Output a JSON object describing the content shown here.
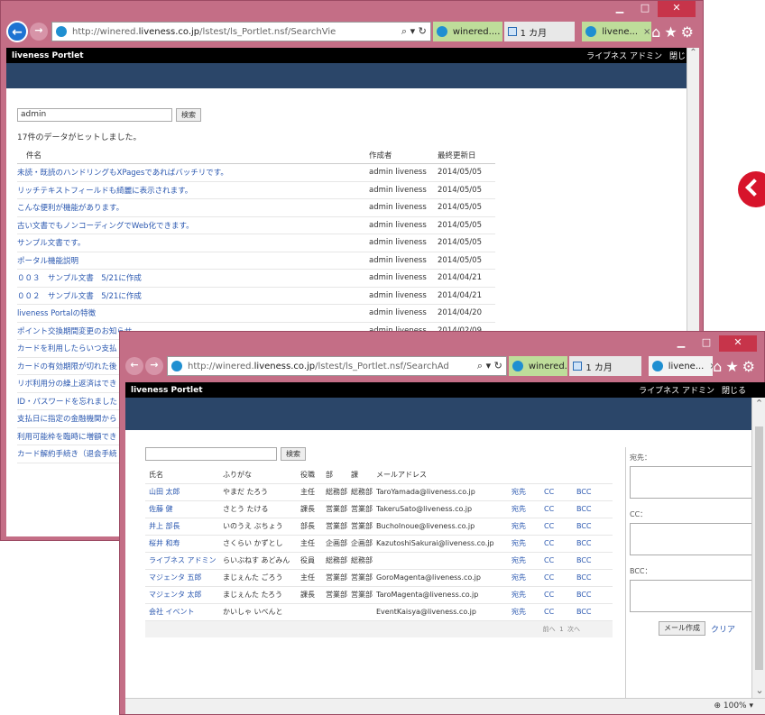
{
  "window1": {
    "address_url_prefix": "http://winered.",
    "address_url_domain": "liveness.co.jp",
    "address_url_suffix": "/lstest/ls_Portlet.nsf/SearchVie",
    "tabs": [
      {
        "label": "winered...."
      },
      {
        "label": "1 カ月"
      },
      {
        "label": "livene...",
        "close": "×"
      }
    ],
    "portal_title": "liveness Portlet",
    "user_name": "ライブネス アドミン",
    "close_link": "閉じる",
    "search_value": "admin",
    "search_button": "検索",
    "result_text": "17件のデータがヒットしました。",
    "columns": {
      "subject": "件名",
      "author": "作成者",
      "updated": "最終更新日"
    },
    "rows": [
      {
        "subject": "未読・既読のハンドリングもXPagesであればバッチリです。",
        "author": "admin liveness",
        "date": "2014/05/05"
      },
      {
        "subject": "リッチテキストフィールドも綺麗に表示されます。",
        "author": "admin liveness",
        "date": "2014/05/05"
      },
      {
        "subject": "こんな便利が機能があります。",
        "author": "admin liveness",
        "date": "2014/05/05"
      },
      {
        "subject": "古い文書でもノンコーディングでWeb化できます。",
        "author": "admin liveness",
        "date": "2014/05/05"
      },
      {
        "subject": "サンプル文書です。",
        "author": "admin liveness",
        "date": "2014/05/05"
      },
      {
        "subject": "ポータル機能説明",
        "author": "admin liveness",
        "date": "2014/05/05"
      },
      {
        "subject": "００３　サンプル文書　5/21に作成",
        "author": "admin liveness",
        "date": "2014/04/21"
      },
      {
        "subject": "００２　サンプル文書　5/21に作成",
        "author": "admin liveness",
        "date": "2014/04/21"
      },
      {
        "subject": "liveness Portalの特徴",
        "author": "admin liveness",
        "date": "2014/04/20"
      },
      {
        "subject": "ポイント交換期間変更のお知らせ",
        "author": "admin liveness",
        "date": "2014/02/09"
      },
      {
        "subject": "カードを利用したらいつ支払",
        "author": "",
        "date": ""
      },
      {
        "subject": "カードの有効期限が切れた後",
        "author": "",
        "date": ""
      },
      {
        "subject": "リボ利用分の繰上返済はでき",
        "author": "",
        "date": ""
      },
      {
        "subject": "ID・パスワードを忘れました",
        "author": "",
        "date": ""
      },
      {
        "subject": "支払日に指定の金融機関から",
        "author": "",
        "date": ""
      },
      {
        "subject": "利用可能枠を臨時に増額でき",
        "author": "",
        "date": ""
      },
      {
        "subject": "カード解約手続き（退会手続",
        "author": "",
        "date": ""
      }
    ]
  },
  "window2": {
    "address_url_prefix": "http://winered.",
    "address_url_domain": "liveness.co.jp",
    "address_url_suffix": "/lstest/ls_Portlet.nsf/SearchAd",
    "tabs": [
      {
        "label": "winered...."
      },
      {
        "label": "1 カ月"
      },
      {
        "label": "livene...",
        "close": "×"
      }
    ],
    "portal_title": "liveness Portlet",
    "user_name": "ライブネス アドミン",
    "close_link": "閉じる",
    "search_value": "",
    "search_button": "検索",
    "columns": {
      "name": "氏名",
      "kana": "ふりがな",
      "title": "役職",
      "dept": "部",
      "section": "課",
      "email": "メールアドレス"
    },
    "rows": [
      {
        "name": "山田 太郎",
        "kana": "やまだ たろう",
        "title": "主任",
        "dept": "総務部",
        "section": "総務部",
        "email": "TaroYamada@liveness.co.jp"
      },
      {
        "name": "佐藤 健",
        "kana": "さとう たける",
        "title": "課長",
        "dept": "営業部",
        "section": "営業部",
        "email": "TakeruSato@liveness.co.jp"
      },
      {
        "name": "井上 部長",
        "kana": "いのうえ ぶちょう",
        "title": "部長",
        "dept": "営業部",
        "section": "営業部",
        "email": "BuchoInoue@liveness.co.jp"
      },
      {
        "name": "桜井 和寿",
        "kana": "さくらい かずとし",
        "title": "主任",
        "dept": "企画部",
        "section": "企画部",
        "email": "KazutoshiSakurai@liveness.co.jp"
      },
      {
        "name": "ライブネス アドミン",
        "kana": "らいぶねす あどみん",
        "title": "役員",
        "dept": "総務部",
        "section": "総務部",
        "email": ""
      },
      {
        "name": "マジェンタ 五郎",
        "kana": "まじぇんた ごろう",
        "title": "主任",
        "dept": "営業部",
        "section": "営業部",
        "email": "GoroMagenta@liveness.co.jp"
      },
      {
        "name": "マジェンタ 太郎",
        "kana": "まじぇんた たろう",
        "title": "課長",
        "dept": "営業部",
        "section": "営業部",
        "email": "TaroMagenta@liveness.co.jp"
      },
      {
        "name": "会社 イベント",
        "kana": "かいしゃ いべんと",
        "title": "",
        "dept": "",
        "section": "",
        "email": "EventKaisya@liveness.co.jp"
      }
    ],
    "action_to": "宛先",
    "action_cc": "CC",
    "action_bcc": "BCC",
    "pager": {
      "prev": "前へ",
      "page": "1",
      "next": "次へ"
    },
    "side": {
      "to_label": "宛先：",
      "cc_label": "CC：",
      "bcc_label": "BCC：",
      "compose_button": "メール作成",
      "clear_link": "クリア"
    },
    "zoom": "100%"
  }
}
